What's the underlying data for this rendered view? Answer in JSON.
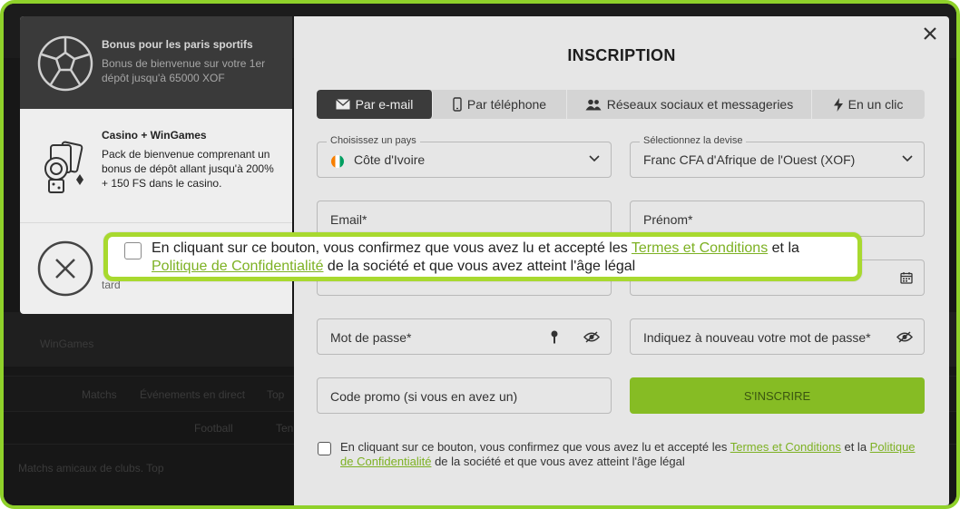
{
  "background": {
    "nav_items": [
      "Matchs",
      "Événements en direct",
      "Top"
    ],
    "filters": [
      "Football",
      "Tennis"
    ],
    "band_label": "WinGames",
    "list_header": "Matchs amicaux de clubs. Top"
  },
  "bonus": {
    "sports": {
      "title": "Bonus pour les paris sportifs",
      "desc": "Bonus de bienvenue sur votre 1er dépôt jusqu'à 65000 XOF"
    },
    "casino": {
      "title": "Casino + WinGames",
      "desc": "Pack de bienvenue comprenant un bonus de dépôt allant jusqu'à 200% + 150 FS dans le casino."
    },
    "none": {
      "desc": "tard"
    }
  },
  "modal": {
    "title": "INSCRIPTION",
    "tabs": [
      {
        "label": "Par e-mail",
        "icon": "envelope-icon",
        "active": true
      },
      {
        "label": "Par téléphone",
        "icon": "phone-icon",
        "active": false
      },
      {
        "label": "Réseaux sociaux et messageries",
        "icon": "users-icon",
        "active": false
      },
      {
        "label": "En un clic",
        "icon": "lightning-icon",
        "active": false
      }
    ],
    "country": {
      "label": "Choisissez un pays",
      "value": "Côte d'Ivoire"
    },
    "currency": {
      "label": "Sélectionnez la devise",
      "value": "Franc CFA d'Afrique de l'Ouest (XOF)"
    },
    "email_placeholder": "Email*",
    "firstname_placeholder": "Prénom*",
    "password_placeholder": "Mot de passe*",
    "password_repeat_placeholder": "Indiquez à nouveau votre mot de passe*",
    "promo_placeholder": "Code promo (si vous en avez un)",
    "submit_label": "S'INSCRIRE",
    "terms": {
      "before": "En cliquant sur ce bouton, vous confirmez que vous avez lu et accepté les ",
      "link1": "Termes et Conditions",
      "middle": " et la ",
      "link2": "Politique de Confidentialité",
      "after": " de la société et que vous avez atteint l'âge légal"
    }
  },
  "colors": {
    "accent_green": "#86bc24",
    "link_green": "#7db123",
    "highlight_border": "#a8d92f",
    "active_tab": "#3b3b3b"
  }
}
